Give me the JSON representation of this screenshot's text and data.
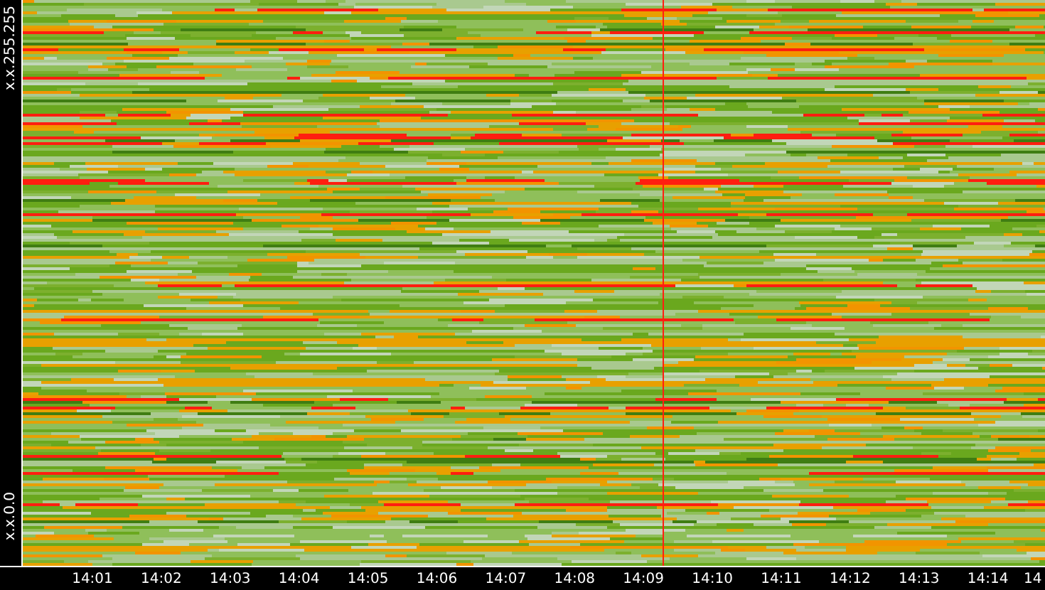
{
  "heatmap": {
    "y_labels": [
      "x.x.255.255",
      "x.x.0.0"
    ],
    "x_labels": [
      "14:01",
      "14:02",
      "14:03",
      "14:04",
      "14:05",
      "14:06",
      "14:07",
      "14:08",
      "14:09",
      "14:10",
      "14:11",
      "14:12",
      "14:13",
      "14:14",
      "14"
    ]
  }
}
